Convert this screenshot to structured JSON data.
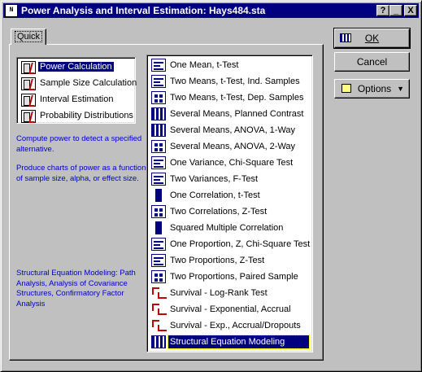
{
  "window": {
    "title": "Power Analysis and Interval Estimation: Hays484.sta",
    "icon_label": "N",
    "controls": {
      "help": "?",
      "minimize": "_",
      "close": "X"
    }
  },
  "tab": {
    "label": "Quick"
  },
  "left_list": {
    "items": [
      {
        "label": "Power Calculation",
        "icon": "power-chart-icon",
        "selected": true
      },
      {
        "label": "Sample Size Calculation",
        "icon": "sample-size-icon",
        "selected": false
      },
      {
        "label": "Interval Estimation",
        "icon": "interval-icon",
        "selected": false
      },
      {
        "label": "Probability Distributions",
        "icon": "distribution-icon",
        "selected": false
      }
    ]
  },
  "description": {
    "line1": "Compute power to detect a specified alternative.",
    "line2": "Produce charts of power as a function of sample size, alpha, or effect size.",
    "line3": "Structural Equation Modeling: Path Analysis, Analysis of Covariance Structures, Confirmatory Factor Analysis"
  },
  "right_list": {
    "items": [
      {
        "label": "One Mean, t-Test",
        "icon": "t-bar"
      },
      {
        "label": "Two Means, t-Test, Ind. Samples",
        "icon": "t-bar"
      },
      {
        "label": "Two Means, t-Test, Dep. Samples",
        "icon": "t-grid"
      },
      {
        "label": "Several Means, Planned Contrast",
        "icon": "t-dense"
      },
      {
        "label": "Several Means, ANOVA, 1-Way",
        "icon": "t-dense"
      },
      {
        "label": "Several Means, ANOVA, 2-Way",
        "icon": "t-grid"
      },
      {
        "label": "One Variance, Chi-Square Test",
        "icon": "t-bar"
      },
      {
        "label": "Two Variances, F-Test",
        "icon": "t-bar"
      },
      {
        "label": "One Correlation, t-Test",
        "icon": "t-block"
      },
      {
        "label": "Two Correlations, Z-Test",
        "icon": "t-grid"
      },
      {
        "label": "Squared Multiple Correlation",
        "icon": "t-block"
      },
      {
        "label": "One Proportion, Z, Chi-Square Test",
        "icon": "t-bar"
      },
      {
        "label": "Two Proportions, Z-Test",
        "icon": "t-bar"
      },
      {
        "label": "Two Proportions, Paired Sample",
        "icon": "t-grid"
      },
      {
        "label": "Survival - Log-Rank Test",
        "icon": "t-surv"
      },
      {
        "label": "Survival - Exponential, Accrual",
        "icon": "t-surv"
      },
      {
        "label": "Survival - Exp., Accrual/Dropouts",
        "icon": "t-surv"
      },
      {
        "label": "Structural Equation Modeling",
        "icon": "t-dense",
        "selected": true
      }
    ]
  },
  "buttons": {
    "ok": "OK",
    "cancel": "Cancel",
    "options": "Options"
  }
}
